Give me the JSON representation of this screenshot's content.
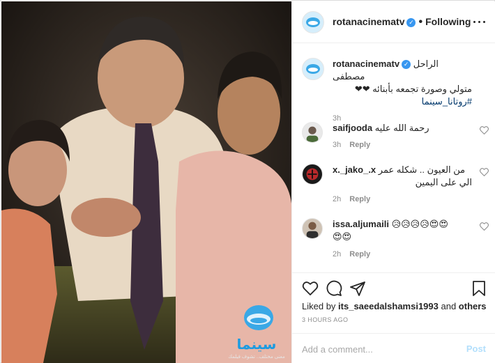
{
  "post": {
    "photo_alt": "Family photo",
    "watermark": {
      "logo_text": "سينما",
      "tagline": "معنى مختلف.. تشوف فيلمك"
    }
  },
  "header": {
    "username": "rotanacinematv",
    "verified_icon": "verified-badge-icon",
    "separator": "•",
    "follow_state": "Following",
    "more_icon": "more-options-icon"
  },
  "comments": [
    {
      "username": "rotanacinematv",
      "verified": true,
      "text_line1": "الراحل مصطفى",
      "text_line2": "متولي وصورة تجمعه بأبنائه ❤❤",
      "hashtag": "#روتانا_سينما",
      "time": "3h",
      "is_caption": true
    },
    {
      "username": "saifjooda",
      "text": "رحمة الله عليه",
      "time": "3h",
      "reply_label": "Reply"
    },
    {
      "username": "x._jako_.x",
      "text_line1": "من العيون .. شكله عمر",
      "text_line2": "الي على اليمين",
      "time": "2h",
      "reply_label": "Reply"
    },
    {
      "username": "issa.aljumaili",
      "text_line1": "😥😥😥😥😍😍",
      "text_line2": "😍😍",
      "time": "2h",
      "reply_label": "Reply"
    }
  ],
  "actions": {
    "like_icon": "heart-icon",
    "comment_icon": "comment-icon",
    "share_icon": "share-icon",
    "save_icon": "bookmark-icon"
  },
  "likes": {
    "prefix": "Liked by ",
    "user": "its_saeedalshamsi1993",
    "joiner": " and ",
    "others": "others"
  },
  "timestamp": "3 HOURS AGO",
  "add_comment": {
    "placeholder": "Add a comment...",
    "post_label": "Post"
  },
  "colors": {
    "accent": "#3897f0",
    "post_disabled": "#b2dffc",
    "muted": "#8e8e8e",
    "hashtag": "#00376b",
    "heart_red": "#ed4956"
  }
}
